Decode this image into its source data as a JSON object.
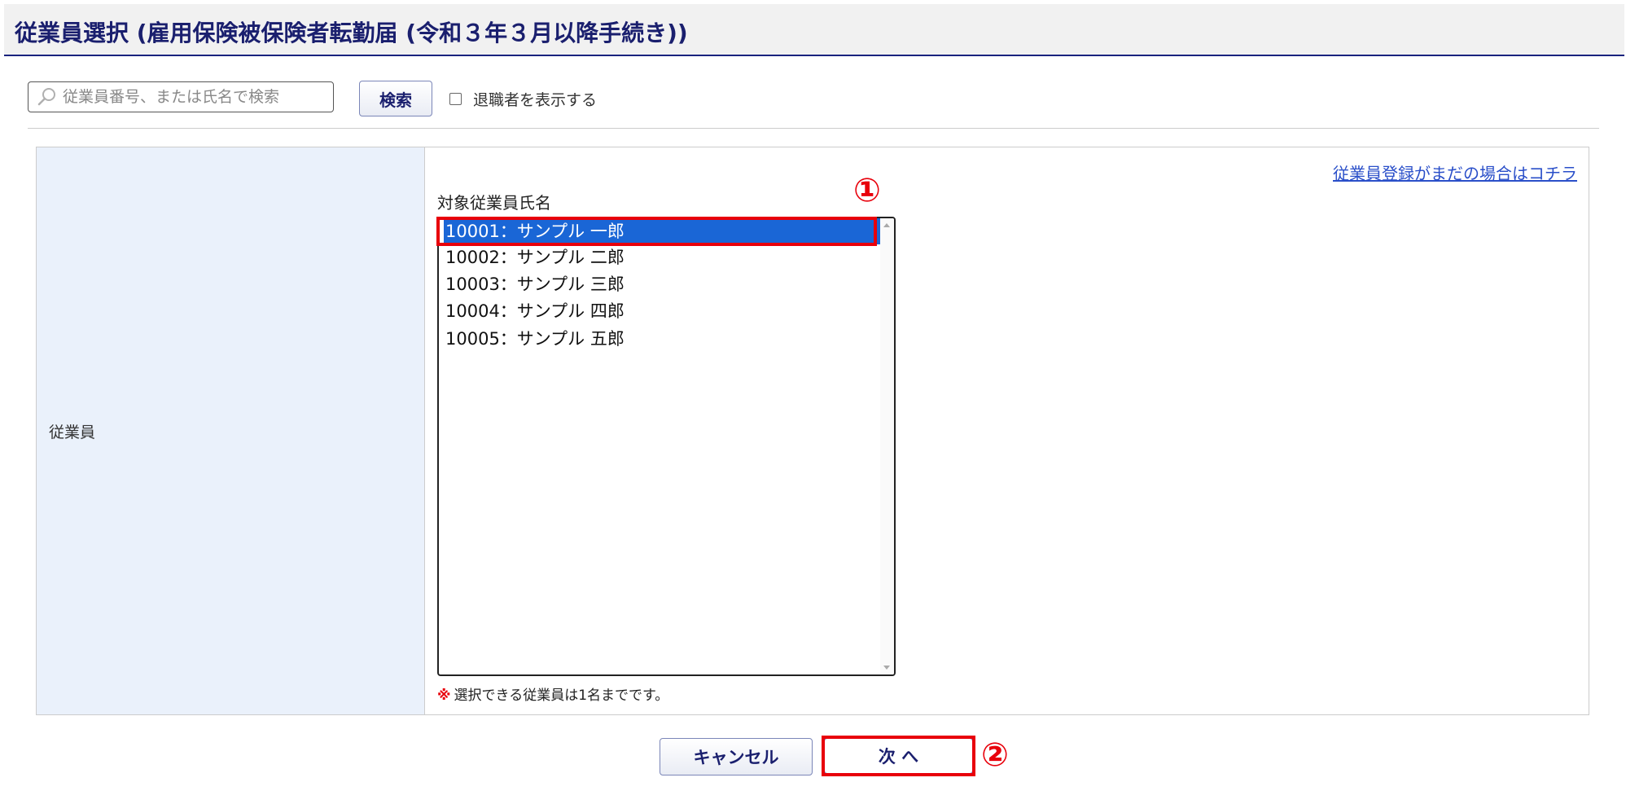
{
  "header": {
    "title": "従業員選択 (雇用保険被保険者転勤届 (令和３年３月以降手続き))"
  },
  "search": {
    "placeholder": "従業員番号、または氏名で検索",
    "button_label": "検索",
    "show_retired_label": "退職者を表示する",
    "show_retired_checked": false
  },
  "form": {
    "row_label": "従業員",
    "register_link": "従業員登録がまだの場合はコチラ",
    "list_label": "対象従業員氏名",
    "employees": [
      "10001：サンプル 一郎",
      "10002：サンプル 二郎",
      "10003：サンプル 三郎",
      "10004：サンプル 四郎",
      "10005：サンプル 五郎"
    ],
    "selected_index": 0,
    "note_mark": "※",
    "note_text": "選択できる従業員は1名までです。"
  },
  "buttons": {
    "cancel_label": "キャンセル",
    "next_label": "次 へ"
  },
  "annotations": {
    "marker_1": "①",
    "marker_2": "②",
    "color": "#e8000b"
  },
  "colors": {
    "header_text": "#1a1f6e",
    "selection": "#1a66d6",
    "label_cell_bg": "#eaf1fb",
    "link": "#2a4fc9"
  }
}
